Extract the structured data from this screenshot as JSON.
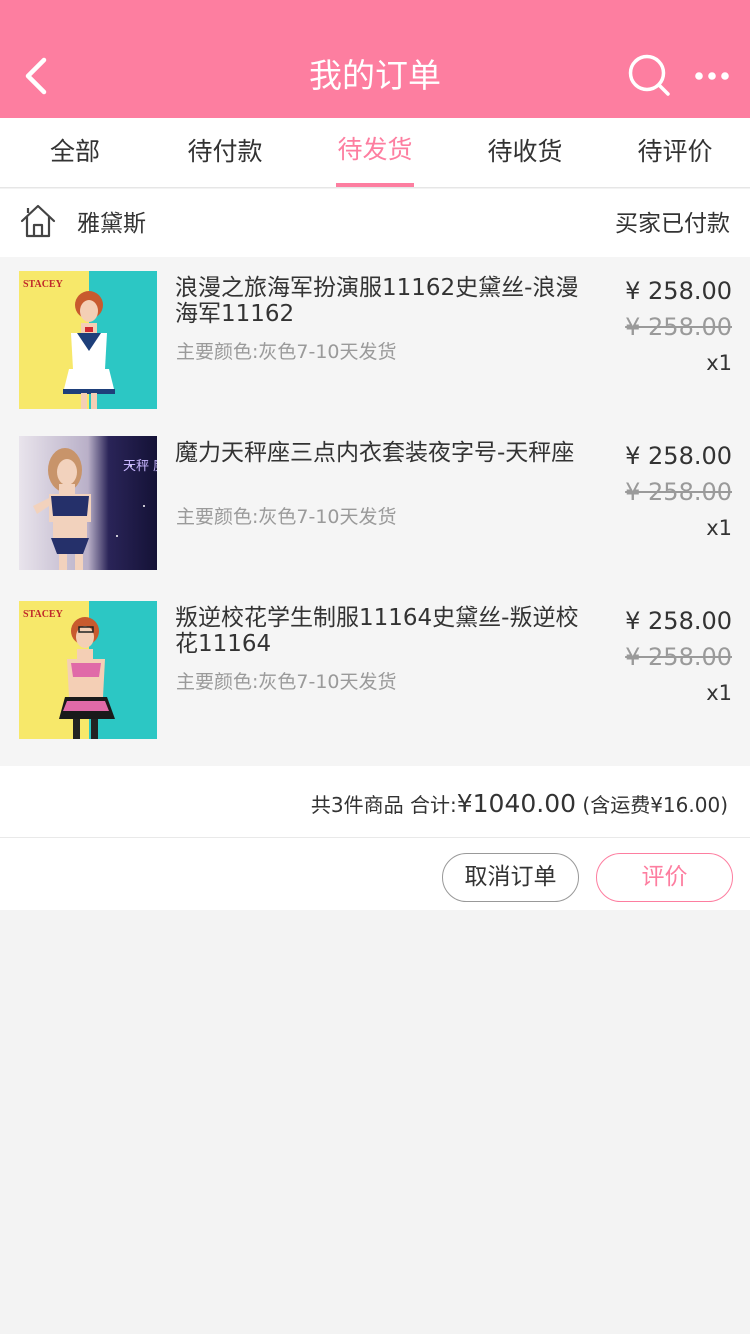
{
  "header": {
    "title": "我的订单",
    "back_icon": "chevron-left-icon",
    "search_icon": "search-icon",
    "more_icon": "more-icon",
    "background_color": "#fd7ea0"
  },
  "tabs": [
    {
      "label": "全部",
      "active": false
    },
    {
      "label": "待付款",
      "active": false
    },
    {
      "label": "待发货",
      "active": true
    },
    {
      "label": "待收货",
      "active": false
    },
    {
      "label": "待评价",
      "active": false
    }
  ],
  "order": {
    "store_name": "雅黛斯",
    "store_icon": "store-icon",
    "status": "买家已付款",
    "items": [
      {
        "title": "浪漫之旅海军扮演服11162史黛丝-浪漫海军11162",
        "spec": "主要颜色:灰色7-10天发货",
        "price": "¥ 258.00",
        "original_price": "¥ 258.00",
        "quantity": "x1",
        "brand": "STACEY"
      },
      {
        "title": "魔力天秤座三点内衣套装夜字号-天秤座",
        "spec": "主要颜色:灰色7-10天发货",
        "price": "¥ 258.00",
        "original_price": "¥ 258.00",
        "quantity": "x1",
        "brand": "天秤 魔力"
      },
      {
        "title": "叛逆校花学生制服11164史黛丝-叛逆校花11164",
        "spec": "主要颜色:灰色7-10天发货",
        "price": "¥ 258.00",
        "original_price": "¥ 258.00",
        "quantity": "x1",
        "brand": "STACEY"
      }
    ],
    "summary": {
      "count_label": "共3件商品",
      "total_label": "合计:",
      "total_value": "¥1040.00",
      "shipping": "(含运费¥16.00)"
    },
    "actions": {
      "cancel_label": "取消订单",
      "review_label": "评价"
    }
  },
  "colors": {
    "accent": "#fd7ea0",
    "page_background": "#f3f3f3"
  }
}
